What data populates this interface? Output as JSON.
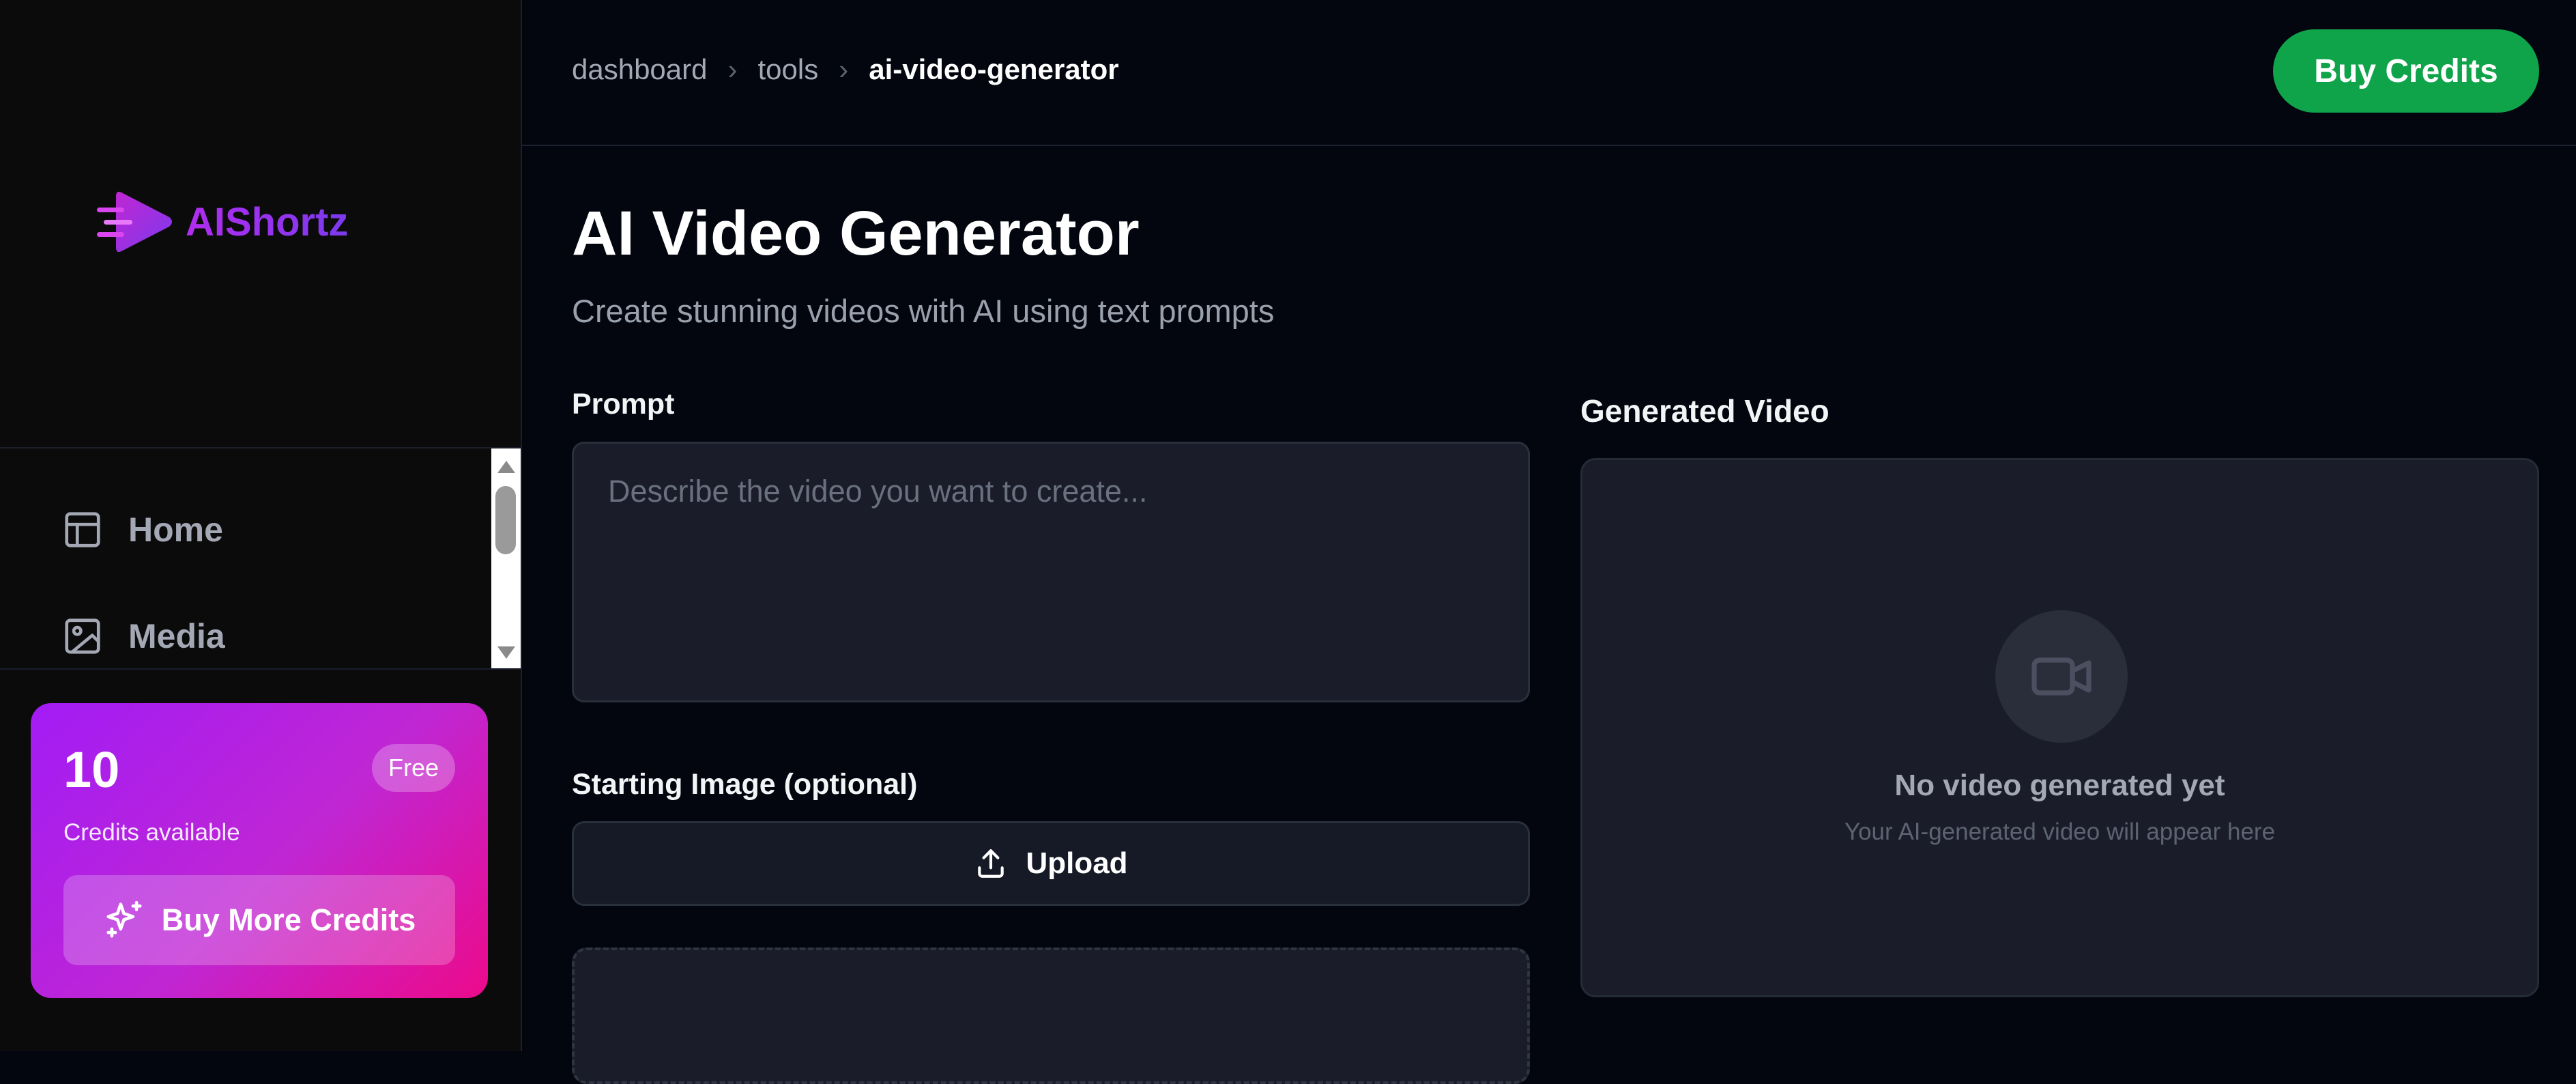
{
  "brand": {
    "name": "AIShortz"
  },
  "sidebar": {
    "items": [
      {
        "label": "Home",
        "icon": "layout-icon"
      },
      {
        "label": "Media",
        "icon": "image-icon"
      }
    ],
    "credits": {
      "count": "10",
      "plan": "Free",
      "label": "Credits available",
      "buy_more_label": "Buy More Credits"
    }
  },
  "header": {
    "breadcrumb": [
      "dashboard",
      "tools",
      "ai-video-generator"
    ],
    "buy_credits_label": "Buy Credits"
  },
  "main": {
    "title": "AI Video Generator",
    "subtitle": "Create stunning videos with AI using text prompts",
    "prompt": {
      "label": "Prompt",
      "placeholder": "Describe the video you want to create...",
      "value": ""
    },
    "starting_image": {
      "label": "Starting Image (optional)",
      "upload_label": "Upload"
    },
    "generated_video": {
      "label": "Generated Video",
      "empty_title": "No video generated yet",
      "empty_subtitle": "Your AI-generated video will appear here"
    }
  },
  "colors": {
    "background": "#03060f",
    "sidebar": "#0b0b0b",
    "accent_green": "#10a44a",
    "card_gradient_start": "#a21cf5",
    "card_gradient_end": "#ec0a8a",
    "brand_purple": "#b12cf0"
  }
}
